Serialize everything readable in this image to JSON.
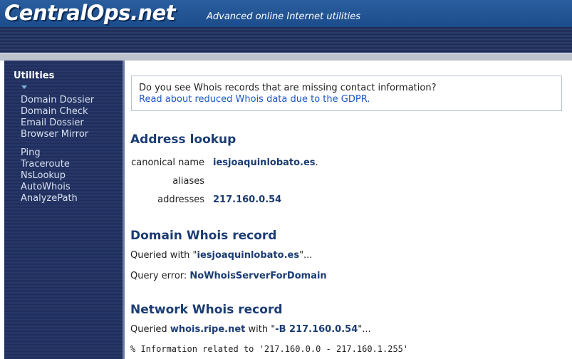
{
  "header": {
    "logo": "CentralOps.net",
    "tagline": "Advanced online Internet utilities"
  },
  "sidebar": {
    "title": "Utilities",
    "group1": [
      "Domain Dossier",
      "Domain Check",
      "Email Dossier",
      "Browser Mirror"
    ],
    "group2": [
      "Ping",
      "Traceroute",
      "NsLookup",
      "AutoWhois",
      "AnalyzePath"
    ]
  },
  "notice": {
    "question": "Do you see Whois records that are missing contact information?",
    "link": "Read about reduced Whois data due to the GDPR."
  },
  "address_lookup": {
    "title": "Address lookup",
    "canonical_label": "canonical name",
    "canonical_value": "iesjoaquinlobato.es",
    "canonical_suffix": ".",
    "aliases_label": "aliases",
    "addresses_label": "addresses",
    "addresses_value": "217.160.0.54"
  },
  "domain_whois": {
    "title": "Domain Whois record",
    "queried_prefix": "Queried with \"",
    "queried_value": "iesjoaquinlobato.es",
    "queried_suffix": "\"...",
    "error_label": "Query error: ",
    "error_value": "NoWhoisServerForDomain"
  },
  "network_whois": {
    "title": "Network Whois record",
    "queried_prefix": "Queried ",
    "server": "whois.ripe.net",
    "with_text": " with \"",
    "args": "-B 217.160.0.54",
    "queried_suffix": "\"...",
    "info_line": "% Information related to '217.160.0.0 - 217.160.1.255'"
  }
}
